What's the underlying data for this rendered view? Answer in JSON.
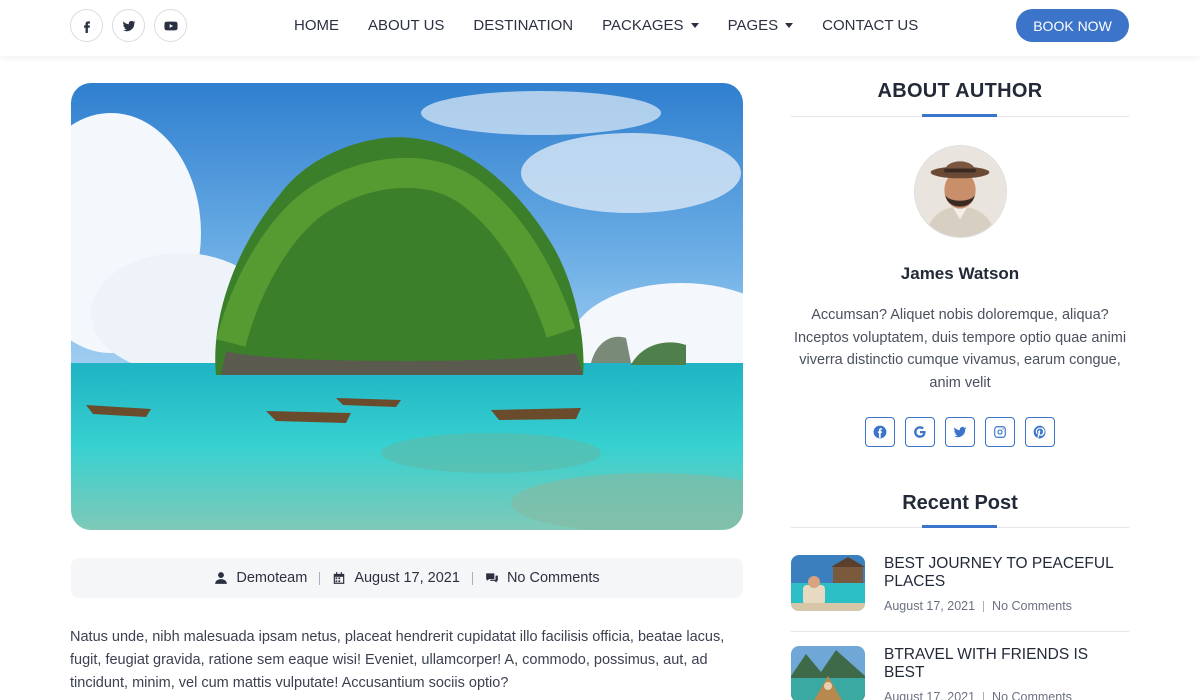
{
  "header": {
    "social": [
      "facebook-icon",
      "twitter-icon",
      "youtube-icon"
    ],
    "nav": [
      {
        "label": "HOME",
        "dropdown": false
      },
      {
        "label": "ABOUT US",
        "dropdown": false
      },
      {
        "label": "DESTINATION",
        "dropdown": false
      },
      {
        "label": "PACKAGES",
        "dropdown": true
      },
      {
        "label": "PAGES",
        "dropdown": true
      },
      {
        "label": "CONTACT US",
        "dropdown": false
      }
    ],
    "book_label": "BOOK NOW"
  },
  "article": {
    "meta": {
      "author": "Demoteam",
      "date": "August 17, 2021",
      "comments": "No Comments"
    },
    "body": "Natus unde, nibh malesuada ipsam netus, placeat hendrerit cupidatat illo facilisis officia, beatae lacus, fugit, feugiat gravida, ratione sem eaque wisi! Eveniet, ullamcorper! A, commodo, possimus, aut, ad tincidunt, minim, vel cum mattis vulputate! Accusantium sociis optio?"
  },
  "sidebar": {
    "about_title": "ABOUT AUTHOR",
    "author_name": "James Watson",
    "author_bio": "Accumsan? Aliquet nobis doloremque, aliqua? Inceptos voluptatem, duis tempore optio quae animi viverra distinctio cumque vivamus, earum congue, anim velit",
    "author_social": [
      "facebook-icon",
      "google-icon",
      "twitter-icon",
      "instagram-icon",
      "pinterest-icon"
    ],
    "recent_title": "Recent Post",
    "posts": [
      {
        "title": "BEST JOURNEY TO PEACEFUL PLACES",
        "date": "August 17, 2021",
        "comments": "No Comments"
      },
      {
        "title": "BTRAVEL WITH FRIENDS IS BEST",
        "date": "August 17, 2021",
        "comments": "No Comments"
      }
    ]
  },
  "colors": {
    "accent": "#3b74c8",
    "text": "#2b3140",
    "meta_bg": "#f5f6f8"
  }
}
